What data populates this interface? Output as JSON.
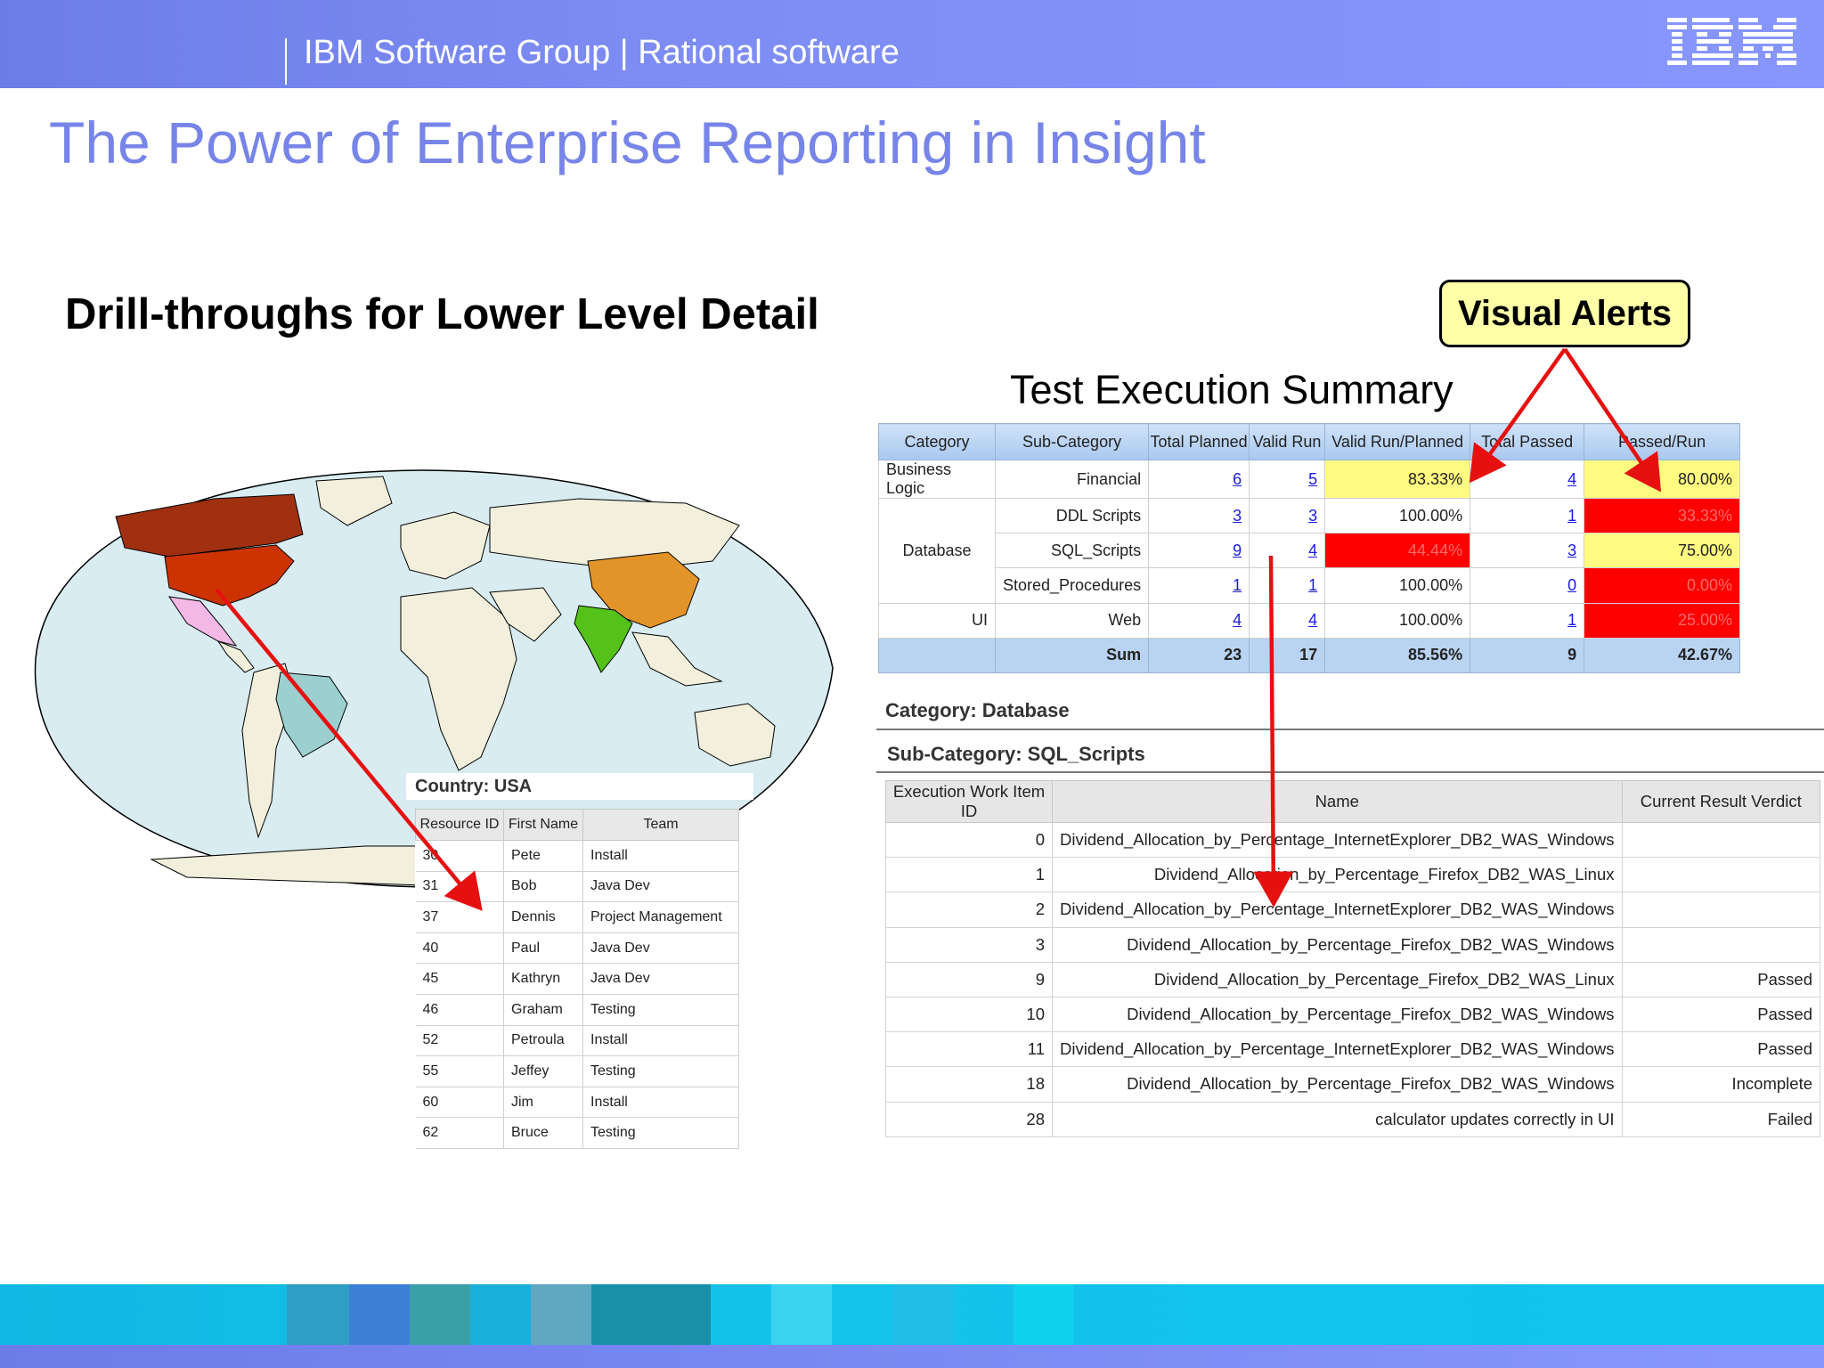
{
  "header": {
    "group_text": "IBM Software Group | Rational software",
    "logo_text": "IBM"
  },
  "slide": {
    "title": "The Power of Enterprise Reporting in Insight",
    "subtitle": "Drill-throughs for Lower Level Detail",
    "callout": "Visual Alerts",
    "summary_title": "Test Execution Summary"
  },
  "map": {
    "highlighted_country": "USA",
    "colors": {
      "usa": "#cc3300",
      "canada": "#a03010",
      "china": "#e39428",
      "india": "#55c21a",
      "brazil": "#9ccfd0",
      "mexico": "#f4b8e6",
      "land": "#f2f0dc",
      "ocean": "#d8ecf2"
    }
  },
  "people": {
    "heading": "Country: USA",
    "columns": [
      "Resource ID",
      "First Name",
      "Team"
    ],
    "rows": [
      [
        "30",
        "Pete",
        "Install"
      ],
      [
        "31",
        "Bob",
        "Java Dev"
      ],
      [
        "37",
        "Dennis",
        "Project Management"
      ],
      [
        "40",
        "Paul",
        "Java Dev"
      ],
      [
        "45",
        "Kathryn",
        "Java Dev"
      ],
      [
        "46",
        "Graham",
        "Testing"
      ],
      [
        "52",
        "Petroula",
        "Install"
      ],
      [
        "55",
        "Jeffey",
        "Testing"
      ],
      [
        "60",
        "Jim",
        "Install"
      ],
      [
        "62",
        "Bruce",
        "Testing"
      ]
    ]
  },
  "summary": {
    "columns": [
      "Category",
      "Sub-Category",
      "Total Planned",
      "Valid Run",
      "Valid Run/Planned",
      "Total Passed",
      "Passed/Run"
    ],
    "rows": [
      [
        "Business Logic",
        "Financial",
        "6",
        "5",
        "83.33%",
        "4",
        "80.00%"
      ],
      [
        "Database",
        "DDL Scripts",
        "3",
        "3",
        "100.00%",
        "1",
        "33.33%"
      ],
      [
        "",
        "SQL_Scripts",
        "9",
        "4",
        "44.44%",
        "3",
        "75.00%"
      ],
      [
        "",
        "Stored_Procedures",
        "1",
        "1",
        "100.00%",
        "0",
        "0.00%"
      ],
      [
        "UI",
        "Web",
        "4",
        "4",
        "100.00%",
        "1",
        "25.00%"
      ]
    ],
    "sum_row": [
      "Sum",
      "23",
      "17",
      "85.56%",
      "9",
      "42.67%"
    ],
    "alert_colors": {
      "warning": "#fffb80",
      "critical": "#ff0000"
    }
  },
  "drill": {
    "category": "Category: Database",
    "sub_category": "Sub-Category: SQL_Scripts",
    "columns": [
      "Execution Work Item ID",
      "Name",
      "Current Result Verdict"
    ],
    "rows": [
      [
        "0",
        "Dividend_Allocation_by_Percentage_InternetExplorer_DB2_WAS_Windows",
        ""
      ],
      [
        "1",
        "Dividend_Allocation_by_Percentage_Firefox_DB2_WAS_Linux",
        ""
      ],
      [
        "2",
        "Dividend_Allocation_by_Percentage_InternetExplorer_DB2_WAS_Windows",
        ""
      ],
      [
        "3",
        "Dividend_Allocation_by_Percentage_Firefox_DB2_WAS_Windows",
        ""
      ],
      [
        "9",
        "Dividend_Allocation_by_Percentage_Firefox_DB2_WAS_Linux",
        "Passed"
      ],
      [
        "10",
        "Dividend_Allocation_by_Percentage_Firefox_DB2_WAS_Windows",
        "Passed"
      ],
      [
        "11",
        "Dividend_Allocation_by_Percentage_InternetExplorer_DB2_WAS_Windows",
        "Passed"
      ],
      [
        "18",
        "Dividend_Allocation_by_Percentage_Firefox_DB2_WAS_Windows",
        "Incomplete"
      ],
      [
        "28",
        "calculator updates correctly in UI",
        "Failed"
      ]
    ]
  },
  "arrow_color": "#e61010"
}
